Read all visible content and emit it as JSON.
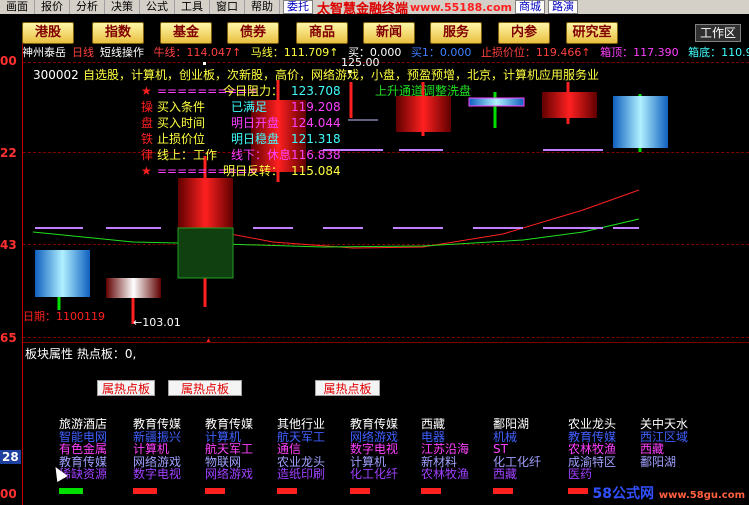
{
  "menu": {
    "items": [
      "画面",
      "报价",
      "分析",
      "决策",
      "公式",
      "工具",
      "窗口",
      "帮助"
    ],
    "tuo": "委托",
    "brand": "太智慧金融终端",
    "url": "www.55188.com",
    "btn_shangcheng": "商城",
    "btn_lujing": "路演"
  },
  "toolbar": {
    "buttons": [
      "港股",
      "指数",
      "基金",
      "债券",
      "商品",
      "新闻",
      "服务",
      "内参",
      "研究室"
    ],
    "workarea": "工作区"
  },
  "info": {
    "stock_name": "神州泰岳",
    "period": "日线",
    "mode": "短线操作",
    "niu": "牛线：114.047↑",
    "ma": "马线：111.709↑",
    "mai": "买：0.000",
    "mai1": "买1：0.000",
    "stoploss": "止损价位：119.466↑",
    "box_top": "箱顶：117.390",
    "box_bottom": "箱底：110.9"
  },
  "axis": {
    "labels": [
      "00",
      "22",
      "43",
      "65",
      "28",
      "00"
    ]
  },
  "annotations": {
    "code": "300002",
    "blocks": "自选股，计算机，创业板，次新股，高价，网络游戏，小盘，预盈预增，北京，计算机应用服务业",
    "row1_star": "★",
    "row1_eq": "==========",
    "row1_label": "今日阻力：",
    "row1_val": "123.708",
    "row2_k": "操",
    "row2_label": "买入条件",
    "row2_sub": "已满足",
    "row2_val": "119.208",
    "row3_k": "盘",
    "row3_label": "买入时间",
    "row3_sub": "明日开盘",
    "row3_val": "124.044",
    "row4_k": "铁",
    "row4_label": "止损价位",
    "row4_sub": "明日稳盘",
    "row4_val": "121.318",
    "row5_k": "律",
    "row5_label": "线上：工作",
    "row5_sub": "线下：休息",
    "row5_val": "116.838",
    "row6_star": "★",
    "row6_eq": "==========",
    "row6_label": "明日反转：",
    "row6_val": "115.084",
    "uptrend": "上升通道调整洗盘",
    "price_high": "125.00",
    "price_low": "←103.01",
    "date": "日期：1100119"
  },
  "block_panel": {
    "title": "板块属性 热点板：0,",
    "hot_buttons": [
      "属热点板",
      "属热点板",
      "属热点板"
    ],
    "columns": [
      {
        "head": "旅游酒店",
        "items": [
          "智能电网",
          "有色金属",
          "教育传媒",
          "稀缺资源"
        ],
        "bar": "#00e000"
      },
      {
        "head": "教育传媒",
        "items": [
          "新疆振兴",
          "计算机",
          "网络游戏",
          "数字电视"
        ],
        "bar": "#ff2020"
      },
      {
        "head": "教育传媒",
        "items": [
          "计算机",
          "航天军工",
          "物联网",
          "网络游戏"
        ],
        "bar": "#ff2020"
      },
      {
        "head": "其他行业",
        "items": [
          "航天军工",
          "通信",
          "农业龙头",
          "造纸印刷"
        ],
        "bar": "#ff2020"
      },
      {
        "head": "教育传媒",
        "items": [
          "网络游戏",
          "数字电视",
          "计算机",
          "化工化纤"
        ],
        "bar": "#ff2020"
      },
      {
        "head": "西藏",
        "items": [
          "电器",
          "江苏沿海",
          "新材料",
          "农林牧渔"
        ],
        "bar": "#ff2020"
      },
      {
        "head": "鄱阳湖",
        "items": [
          "机械",
          "ST",
          "化工化纤",
          "西藏"
        ],
        "bar": "#ff2020"
      },
      {
        "head": "农业龙头",
        "items": [
          "教育传媒",
          "农林牧渔",
          "成渝特区",
          "医药"
        ],
        "bar": "#ff2020"
      },
      {
        "head": "关中天水",
        "items": [
          "西江区域",
          "西藏",
          "鄱阳湖",
          ""
        ],
        "bar": "#ff2020"
      }
    ]
  },
  "watermark": {
    "main": "58公式网",
    "sub": "www.58gu.com"
  },
  "colors": {
    "accent_red": "#ff2020",
    "candle_cyan": "#40c0ff",
    "ma_green": "#00e000"
  }
}
